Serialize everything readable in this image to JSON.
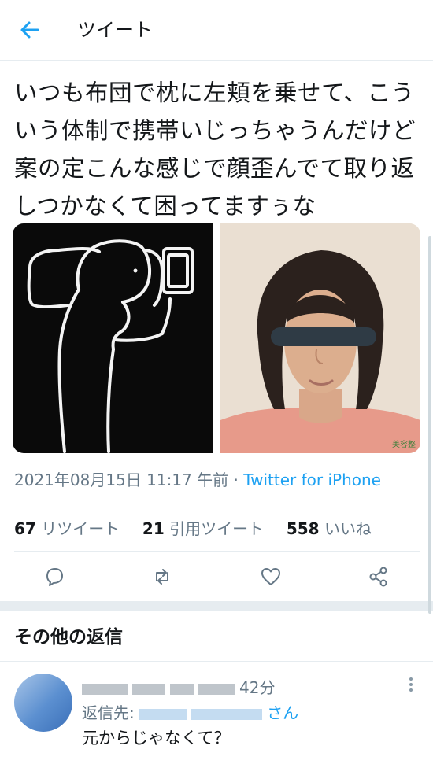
{
  "header": {
    "title": "ツイート",
    "back_icon": "arrow-left-icon"
  },
  "tweet": {
    "text": "いつも布団で枕に左頬を乗せて、こういう体制で携帯いじっちゃうんだけど案の定こんな感じで顔歪んでて取り返しつかなくて困ってますぅな",
    "images": [
      {
        "name": "sketch-image",
        "description_icon": "drawing"
      },
      {
        "name": "face-photo",
        "watermark": "美容整"
      }
    ],
    "date": "2021年08月15日 11:17 午前",
    "separator": " · ",
    "source": "Twitter for iPhone",
    "stats": {
      "retweets_count": "67",
      "retweets_label": "リツイート",
      "quotes_count": "21",
      "quotes_label": "引用ツイート",
      "likes_count": "558",
      "likes_label": "いいね"
    },
    "actions": [
      "reply-icon",
      "retweet-icon",
      "like-icon",
      "share-icon"
    ]
  },
  "section": {
    "title": "その他の返信"
  },
  "reply": {
    "time": "42分",
    "replyto_prefix": "返信先:",
    "replyto_suffix": "さん",
    "text": "元からじゃなくて？"
  },
  "colors": {
    "accent": "#1da1f2",
    "text": "#14171a",
    "muted": "#657786",
    "border": "#e6ecf0"
  }
}
